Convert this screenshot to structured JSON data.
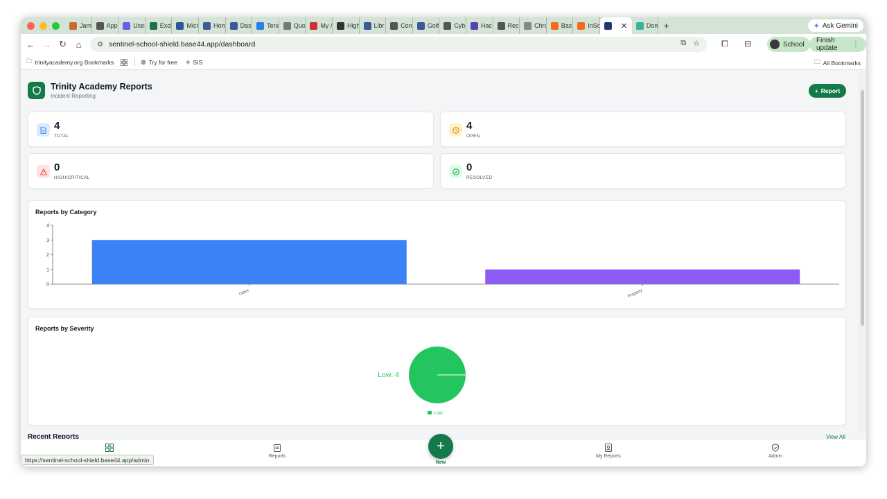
{
  "browser": {
    "tabs": [
      {
        "label": "Jam",
        "color": "#c96a2e"
      },
      {
        "label": "App",
        "color": "#555555"
      },
      {
        "label": "User",
        "color": "#6c5ce7"
      },
      {
        "label": "Excl",
        "color": "#1e7145"
      },
      {
        "label": "Micr",
        "color": "#2b579a"
      },
      {
        "label": "Hom",
        "color": "#3b5998"
      },
      {
        "label": "Dasl",
        "color": "#3b5998"
      },
      {
        "label": "Tena",
        "color": "#2b7de9"
      },
      {
        "label": "Quo",
        "color": "#777777"
      },
      {
        "label": "My /",
        "color": "#d32f2f"
      },
      {
        "label": "High",
        "color": "#333333"
      },
      {
        "label": "Libr",
        "color": "#3b5998"
      },
      {
        "label": "Con",
        "color": "#555555"
      },
      {
        "label": "Golf",
        "color": "#3b5998"
      },
      {
        "label": "Cyb",
        "color": "#555555"
      },
      {
        "label": "Hac",
        "color": "#5b3fb5"
      },
      {
        "label": "Rec",
        "color": "#555555"
      },
      {
        "label": "Chro",
        "color": "#888888"
      },
      {
        "label": "Bas",
        "color": "#f26b21"
      },
      {
        "label": "InSc",
        "color": "#f26b21"
      }
    ],
    "active_tab_color": "#1f3a6b",
    "extra_tab": {
      "label": "Dom",
      "color": "#3ab0a0"
    },
    "ask_gemini": "Ask Gemini",
    "url": "sentinel-school-shield.base44.app/dashboard",
    "profile": "School",
    "finish_update": "Finish update",
    "bookmarks": [
      {
        "label": "trinityacademy.org Bookmarks"
      },
      {
        "label": "Try for free"
      },
      {
        "label": "SIS"
      }
    ],
    "all_bookmarks": "All Bookmarks",
    "status_url": "https://sentinel-school-shield.base44.app/admin"
  },
  "app": {
    "title": "Trinity Academy Reports",
    "subtitle": "Incident Reporting",
    "report_button": "Report",
    "brand_color": "#157a4a",
    "stats": [
      {
        "value": "4",
        "label": "TOTAL",
        "icon": "file-icon",
        "bg": "#dbeafe",
        "fg": "#3b82f6"
      },
      {
        "value": "4",
        "label": "OPEN",
        "icon": "clock-icon",
        "bg": "#fef3c7",
        "fg": "#d97706"
      },
      {
        "value": "0",
        "label": "HIGH/CRITICAL",
        "icon": "warning-icon",
        "bg": "#fee2e2",
        "fg": "#ef4444"
      },
      {
        "value": "0",
        "label": "RESOLVED",
        "icon": "check-circle-icon",
        "bg": "#dcfce7",
        "fg": "#16a34a"
      }
    ],
    "category_chart_title": "Reports by Category",
    "severity_chart_title": "Reports by Severity",
    "recent_reports": "Recent Reports",
    "view_all": "View All",
    "nav": {
      "dashboard": "",
      "reports": "Reports",
      "new": "New",
      "my_reports": "My Reports",
      "admin": "Admin"
    }
  },
  "chart_data": [
    {
      "type": "bar",
      "title": "Reports by Category",
      "categories": [
        "Other",
        "Property"
      ],
      "values": [
        3,
        1
      ],
      "colors": [
        "#3b82f6",
        "#8b5cf6"
      ],
      "yticks": [
        0,
        1,
        2,
        3,
        4
      ],
      "ylim": [
        0,
        4
      ],
      "grid": false
    },
    {
      "type": "pie",
      "title": "Reports by Severity",
      "labels": [
        "Low"
      ],
      "values": [
        4
      ],
      "colors": [
        "#22c55e"
      ],
      "data_label": "Low: 4",
      "legend": [
        "Low"
      ],
      "legend_position": "bottom"
    }
  ]
}
